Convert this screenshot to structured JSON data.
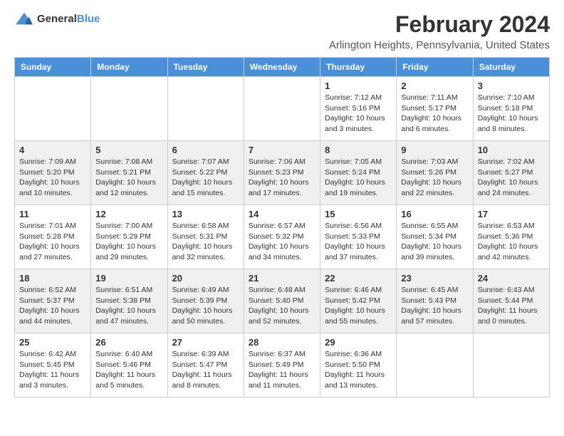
{
  "logo": {
    "general": "General",
    "blue": "Blue"
  },
  "title": "February 2024",
  "subtitle": "Arlington Heights, Pennsylvania, United States",
  "headers": [
    "Sunday",
    "Monday",
    "Tuesday",
    "Wednesday",
    "Thursday",
    "Friday",
    "Saturday"
  ],
  "weeks": [
    [
      {
        "day": "",
        "info": ""
      },
      {
        "day": "",
        "info": ""
      },
      {
        "day": "",
        "info": ""
      },
      {
        "day": "",
        "info": ""
      },
      {
        "day": "1",
        "info": "Sunrise: 7:12 AM\nSunset: 5:16 PM\nDaylight: 10 hours\nand 3 minutes."
      },
      {
        "day": "2",
        "info": "Sunrise: 7:11 AM\nSunset: 5:17 PM\nDaylight: 10 hours\nand 6 minutes."
      },
      {
        "day": "3",
        "info": "Sunrise: 7:10 AM\nSunset: 5:18 PM\nDaylight: 10 hours\nand 8 minutes."
      }
    ],
    [
      {
        "day": "4",
        "info": "Sunrise: 7:09 AM\nSunset: 5:20 PM\nDaylight: 10 hours\nand 10 minutes."
      },
      {
        "day": "5",
        "info": "Sunrise: 7:08 AM\nSunset: 5:21 PM\nDaylight: 10 hours\nand 12 minutes."
      },
      {
        "day": "6",
        "info": "Sunrise: 7:07 AM\nSunset: 5:22 PM\nDaylight: 10 hours\nand 15 minutes."
      },
      {
        "day": "7",
        "info": "Sunrise: 7:06 AM\nSunset: 5:23 PM\nDaylight: 10 hours\nand 17 minutes."
      },
      {
        "day": "8",
        "info": "Sunrise: 7:05 AM\nSunset: 5:24 PM\nDaylight: 10 hours\nand 19 minutes."
      },
      {
        "day": "9",
        "info": "Sunrise: 7:03 AM\nSunset: 5:26 PM\nDaylight: 10 hours\nand 22 minutes."
      },
      {
        "day": "10",
        "info": "Sunrise: 7:02 AM\nSunset: 5:27 PM\nDaylight: 10 hours\nand 24 minutes."
      }
    ],
    [
      {
        "day": "11",
        "info": "Sunrise: 7:01 AM\nSunset: 5:28 PM\nDaylight: 10 hours\nand 27 minutes."
      },
      {
        "day": "12",
        "info": "Sunrise: 7:00 AM\nSunset: 5:29 PM\nDaylight: 10 hours\nand 29 minutes."
      },
      {
        "day": "13",
        "info": "Sunrise: 6:58 AM\nSunset: 5:31 PM\nDaylight: 10 hours\nand 32 minutes."
      },
      {
        "day": "14",
        "info": "Sunrise: 6:57 AM\nSunset: 5:32 PM\nDaylight: 10 hours\nand 34 minutes."
      },
      {
        "day": "15",
        "info": "Sunrise: 6:56 AM\nSunset: 5:33 PM\nDaylight: 10 hours\nand 37 minutes."
      },
      {
        "day": "16",
        "info": "Sunrise: 6:55 AM\nSunset: 5:34 PM\nDaylight: 10 hours\nand 39 minutes."
      },
      {
        "day": "17",
        "info": "Sunrise: 6:53 AM\nSunset: 5:36 PM\nDaylight: 10 hours\nand 42 minutes."
      }
    ],
    [
      {
        "day": "18",
        "info": "Sunrise: 6:52 AM\nSunset: 5:37 PM\nDaylight: 10 hours\nand 44 minutes."
      },
      {
        "day": "19",
        "info": "Sunrise: 6:51 AM\nSunset: 5:38 PM\nDaylight: 10 hours\nand 47 minutes."
      },
      {
        "day": "20",
        "info": "Sunrise: 6:49 AM\nSunset: 5:39 PM\nDaylight: 10 hours\nand 50 minutes."
      },
      {
        "day": "21",
        "info": "Sunrise: 6:48 AM\nSunset: 5:40 PM\nDaylight: 10 hours\nand 52 minutes."
      },
      {
        "day": "22",
        "info": "Sunrise: 6:46 AM\nSunset: 5:42 PM\nDaylight: 10 hours\nand 55 minutes."
      },
      {
        "day": "23",
        "info": "Sunrise: 6:45 AM\nSunset: 5:43 PM\nDaylight: 10 hours\nand 57 minutes."
      },
      {
        "day": "24",
        "info": "Sunrise: 6:43 AM\nSunset: 5:44 PM\nDaylight: 11 hours\nand 0 minutes."
      }
    ],
    [
      {
        "day": "25",
        "info": "Sunrise: 6:42 AM\nSunset: 5:45 PM\nDaylight: 11 hours\nand 3 minutes."
      },
      {
        "day": "26",
        "info": "Sunrise: 6:40 AM\nSunset: 5:46 PM\nDaylight: 11 hours\nand 5 minutes."
      },
      {
        "day": "27",
        "info": "Sunrise: 6:39 AM\nSunset: 5:47 PM\nDaylight: 11 hours\nand 8 minutes."
      },
      {
        "day": "28",
        "info": "Sunrise: 6:37 AM\nSunset: 5:49 PM\nDaylight: 11 hours\nand 11 minutes."
      },
      {
        "day": "29",
        "info": "Sunrise: 6:36 AM\nSunset: 5:50 PM\nDaylight: 11 hours\nand 13 minutes."
      },
      {
        "day": "",
        "info": ""
      },
      {
        "day": "",
        "info": ""
      }
    ]
  ]
}
